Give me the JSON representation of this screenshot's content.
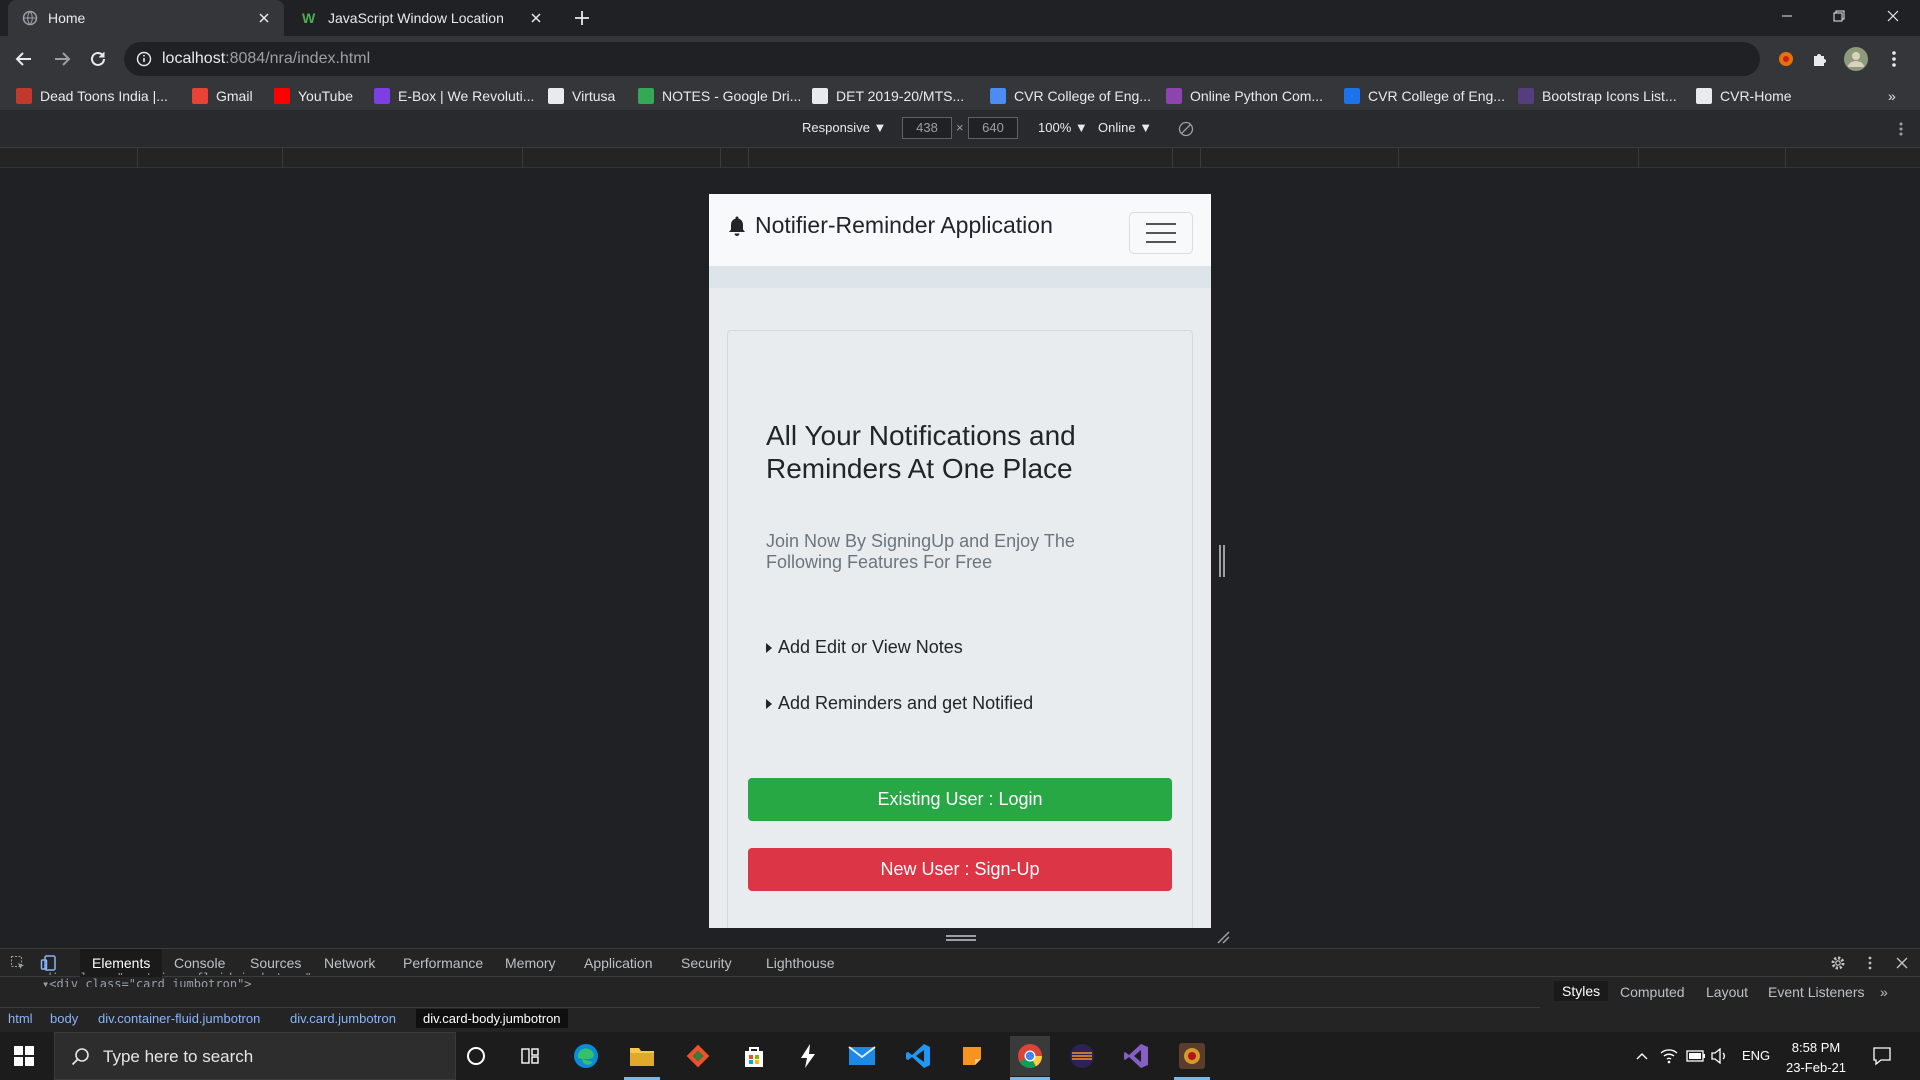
{
  "browser": {
    "tabs": [
      {
        "title": "Home",
        "active": true
      },
      {
        "title": "JavaScript Window Location",
        "active": false
      }
    ],
    "url_host": "localhost",
    "url_path": ":8084/nra/index.html",
    "bookmarks": [
      {
        "label": "Dead Toons India |...",
        "color": "#c0392b"
      },
      {
        "label": "Gmail",
        "color": "#ea4335"
      },
      {
        "label": "YouTube",
        "color": "#ff0000"
      },
      {
        "label": "E-Box | We Revoluti...",
        "color": "#7b3fe4"
      },
      {
        "label": "Virtusa",
        "color": "#e8eaed"
      },
      {
        "label": "NOTES - Google Dri...",
        "color": "#34a853"
      },
      {
        "label": "DET 2019-20/MTS...",
        "color": "#e8eaed"
      },
      {
        "label": "CVR College of Eng...",
        "color": "#4d8bf5"
      },
      {
        "label": "Online Python Com...",
        "color": "#8e44ad"
      },
      {
        "label": "CVR College of Eng...",
        "color": "#1a73e8"
      },
      {
        "label": "Bootstrap Icons List...",
        "color": "#563d7c"
      },
      {
        "label": "CVR-Home",
        "color": "#e8eaed"
      }
    ]
  },
  "device_toolbar": {
    "mode": "Responsive ▼",
    "width": "438",
    "times": "×",
    "height": "640",
    "zoom": "100% ▼",
    "network": "Online ▼"
  },
  "app": {
    "brand": "Notifier-Reminder Application",
    "hero_title": "All Your Notifications and Reminders At One Place",
    "hero_lead": "Join Now By SigningUp and Enjoy The Following Features For Free",
    "features": [
      "Add Edit or View Notes",
      "Add Reminders and get Notified"
    ],
    "login_button": "Existing User : Login",
    "signup_button": "New User : Sign-Up",
    "colors": {
      "login": "#28a745",
      "signup": "#dc3545"
    }
  },
  "devtools": {
    "tabs": [
      "Elements",
      "Console",
      "Sources",
      "Network",
      "Performance",
      "Memory",
      "Application",
      "Security",
      "Lighthouse"
    ],
    "dom_line_1": "▾<div class=\"container-fluid jumbotron\">",
    "dom_line_2": "▾<div class=\"card jumbotron\">",
    "breadcrumbs": [
      "html",
      "body",
      "div.container-fluid.jumbotron",
      "div.card.jumbotron",
      "div.card-body.jumbotron"
    ],
    "side_tabs": [
      "Styles",
      "Computed",
      "Layout",
      "Event Listeners",
      "»"
    ]
  },
  "taskbar": {
    "search_placeholder": "Type here to search",
    "language": "ENG",
    "time": "8:58 PM",
    "date": "23-Feb-21"
  }
}
